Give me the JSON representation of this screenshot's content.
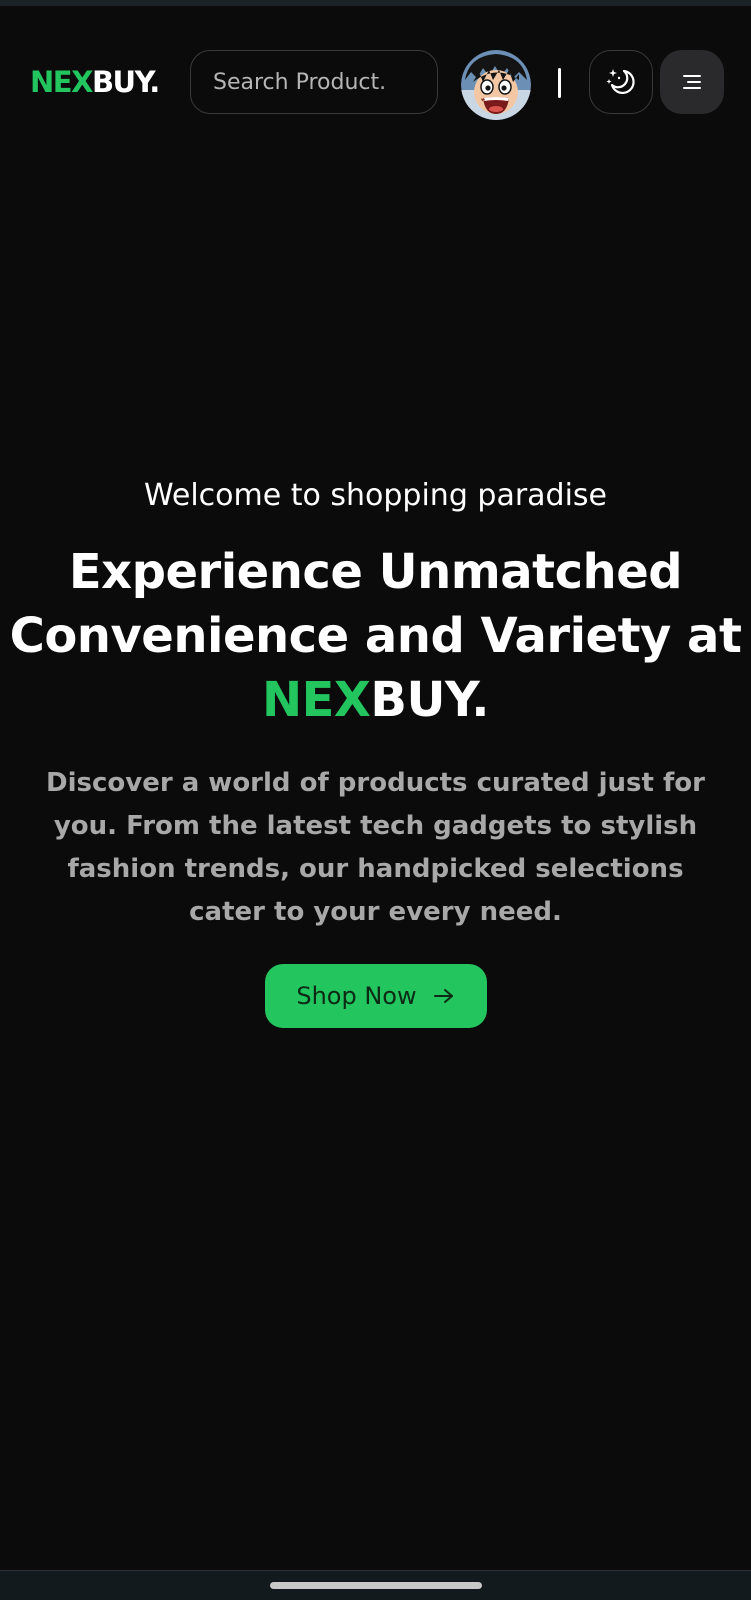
{
  "header": {
    "logo_accent": "NEX",
    "logo_rest": "BUY.",
    "search_placeholder": "Search Product.",
    "icons": {
      "theme": "moon-stars-icon",
      "menu": "menu-icon",
      "avatar": "user-avatar"
    }
  },
  "hero": {
    "welcome": "Welcome to shopping paradise",
    "headline_part1": "Experience Unmatched Convenience and Variety at ",
    "headline_accent": "NEX",
    "headline_rest": "BUY.",
    "description": "Discover a world of products curated just for you. From the latest tech gadgets to stylish fashion trends, our handpicked selections cater to your every need.",
    "cta_label": "Shop Now",
    "cta_icon": "arrow-right-icon"
  },
  "colors": {
    "background": "#0b0b0b",
    "accent": "#22c55e",
    "text": "#ffffff",
    "muted_text": "#a8a8a8",
    "menu_button_bg": "#2a2a2c"
  }
}
